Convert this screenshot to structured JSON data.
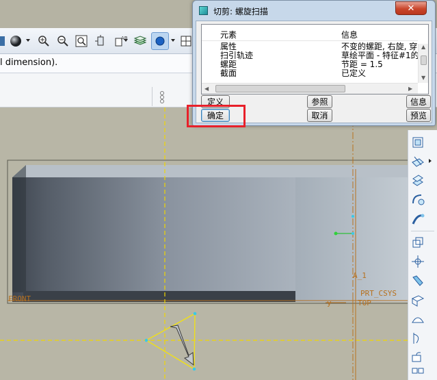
{
  "dialog": {
    "title": "切剪: 螺旋扫描",
    "close_label": "✕",
    "list": {
      "headers": {
        "element": "元素",
        "info": "信息"
      },
      "rows": [
        {
          "element": "属性",
          "info": "不变的螺距, 右旋, 穿"
        },
        {
          "element": "扫引轨迹",
          "info": "草绘平面 - 特征#1的"
        },
        {
          "element": "螺距",
          "info": "节距 = 1.5"
        },
        {
          "element": "截面",
          "info": "已定义"
        }
      ]
    },
    "buttons": {
      "define": "定义",
      "refs": "参照",
      "info": "信息",
      "ok": "确定",
      "cancel": "取消",
      "preview": "预览"
    }
  },
  "message": {
    "text": "l dimension)."
  },
  "toolbar": {
    "icons": [
      "shading-icon",
      "zoom-in-icon",
      "zoom-out-icon",
      "refit-icon",
      "orient-icon",
      "view-manager-icon",
      "layers-icon",
      "display-style-icon",
      "datum-display-icon"
    ]
  },
  "viewport": {
    "labels": {
      "front": "FRONT",
      "axis": "A_1",
      "csys": "PRT_CSYS",
      "top": "TOP",
      "y": "y"
    }
  },
  "colors": {
    "datum": "#b7711f",
    "highlight": "#e8202a",
    "dialog_frame": "#c7d8ea"
  }
}
